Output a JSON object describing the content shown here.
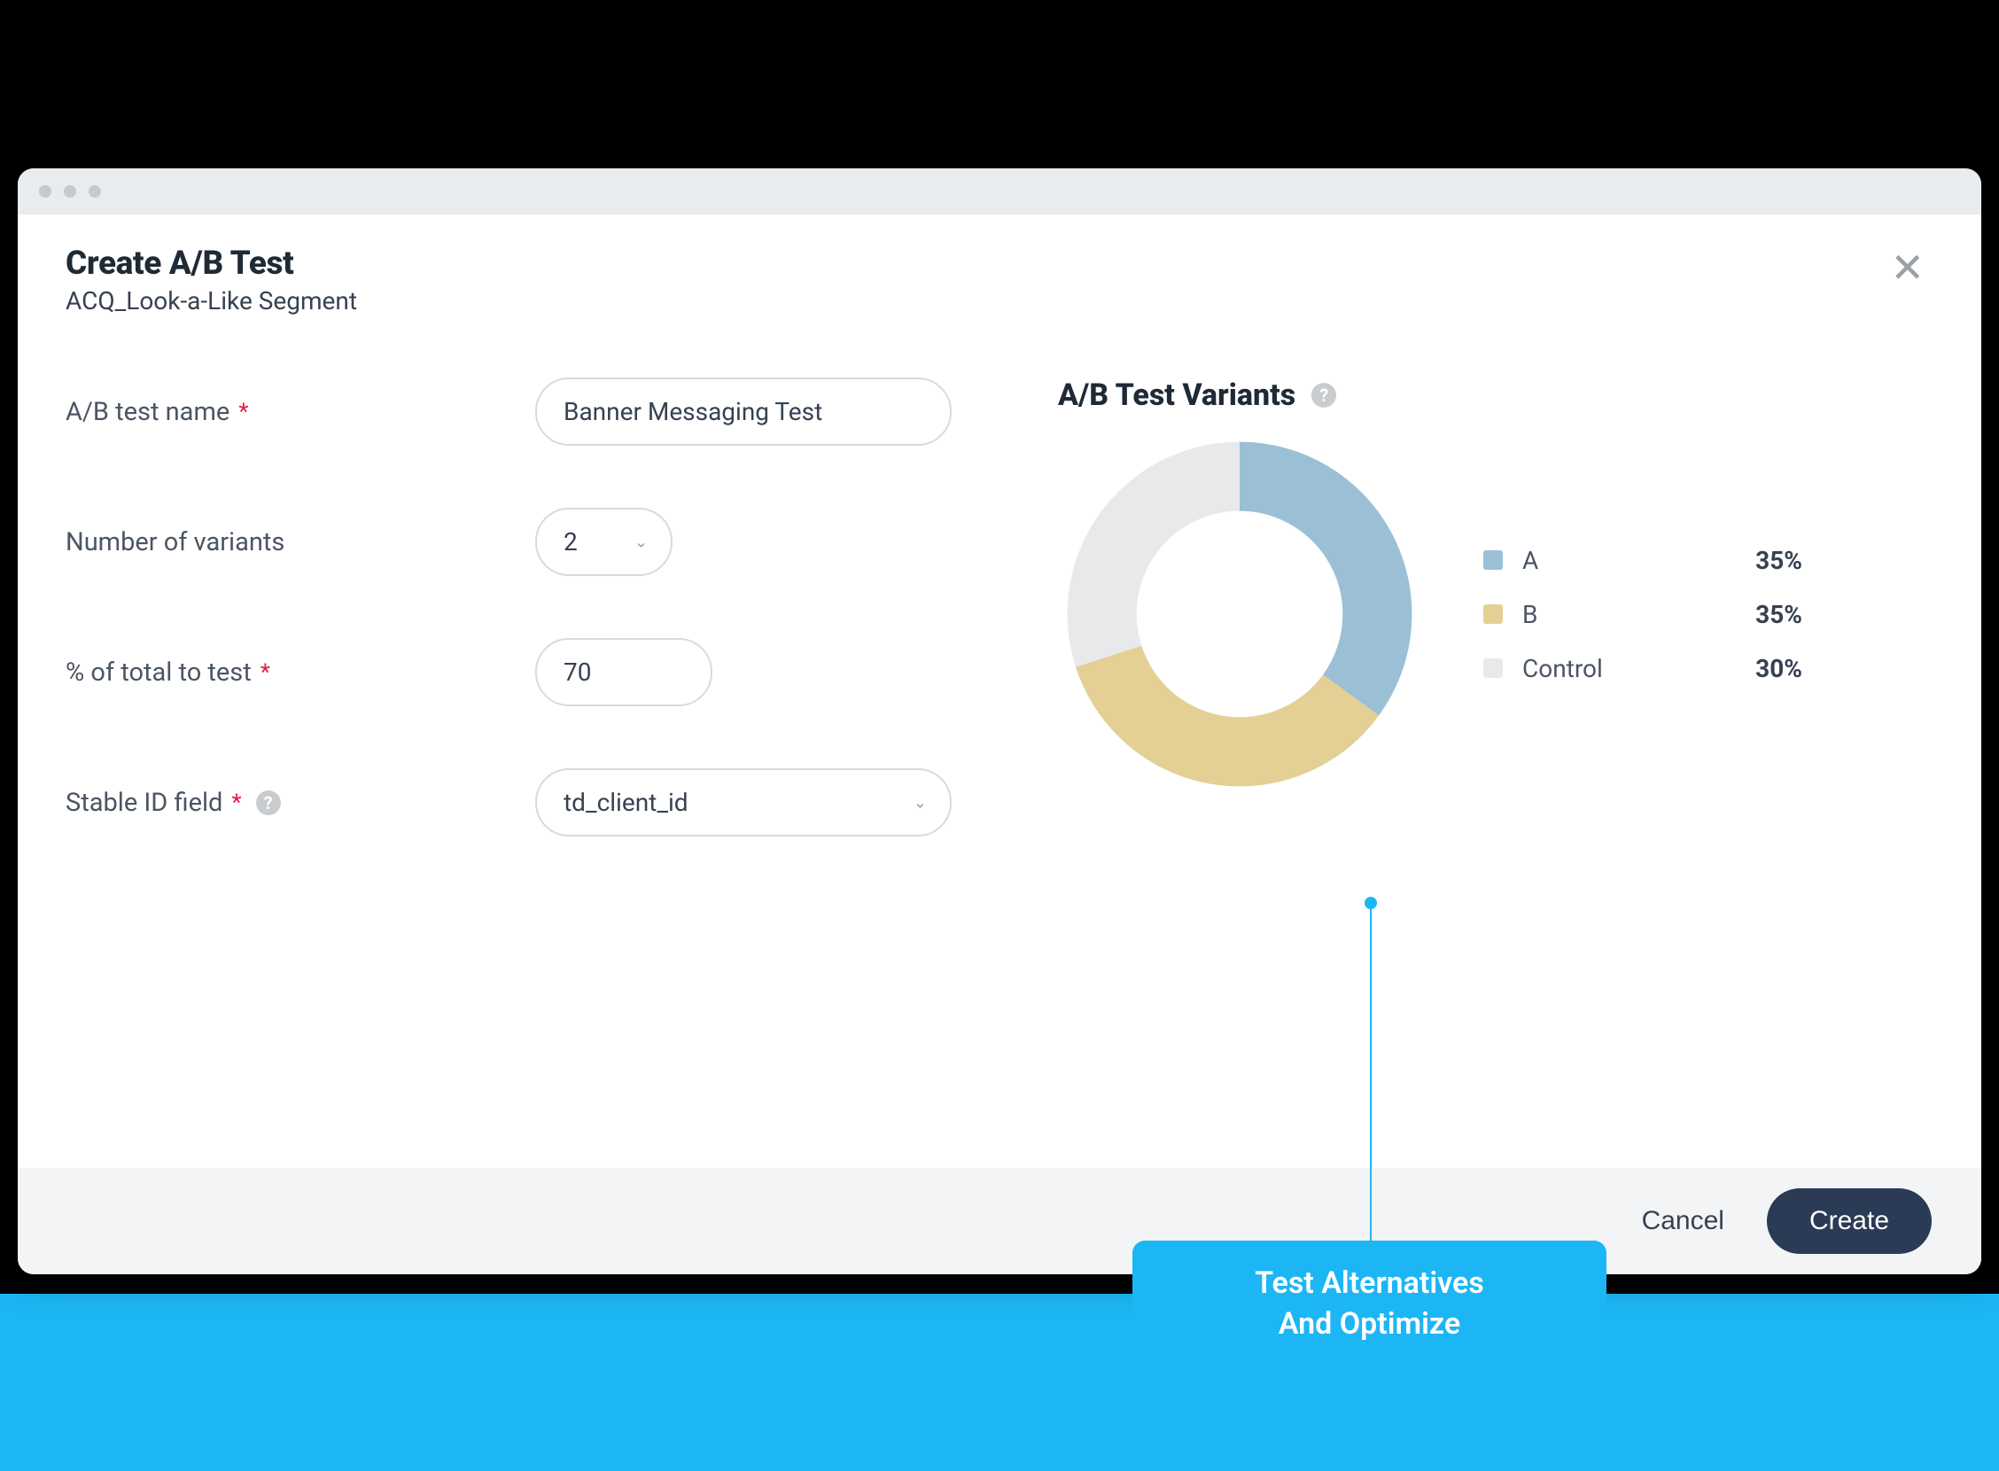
{
  "header": {
    "title": "Create A/B Test",
    "subtitle": "ACQ_Look-a-Like Segment"
  },
  "form": {
    "test_name_label": "A/B test name",
    "test_name_value": "Banner Messaging Test",
    "num_variants_label": "Number of variants",
    "num_variants_value": "2",
    "pct_total_label": "% of total to test",
    "pct_total_value": "70",
    "stable_id_label": "Stable ID field",
    "stable_id_value": "td_client_id"
  },
  "variants": {
    "title": "A/B Test Variants",
    "legend": [
      {
        "label": "A",
        "value": "35%",
        "color": "#9bc0d6"
      },
      {
        "label": "B",
        "value": "35%",
        "color": "#e4cf94"
      },
      {
        "label": "Control",
        "value": "30%",
        "color": "#e7e9eb"
      }
    ]
  },
  "chart_data": {
    "type": "pie",
    "title": "A/B Test Variants",
    "series": [
      {
        "name": "A",
        "value": 35,
        "color": "#9bc0d6"
      },
      {
        "name": "B",
        "value": 35,
        "color": "#e4cf94"
      },
      {
        "name": "Control",
        "value": 30,
        "color": "#e7e9eb"
      }
    ]
  },
  "footer": {
    "cancel": "Cancel",
    "create": "Create"
  },
  "callout": {
    "line1": "Test Alternatives",
    "line2": "And Optimize"
  }
}
